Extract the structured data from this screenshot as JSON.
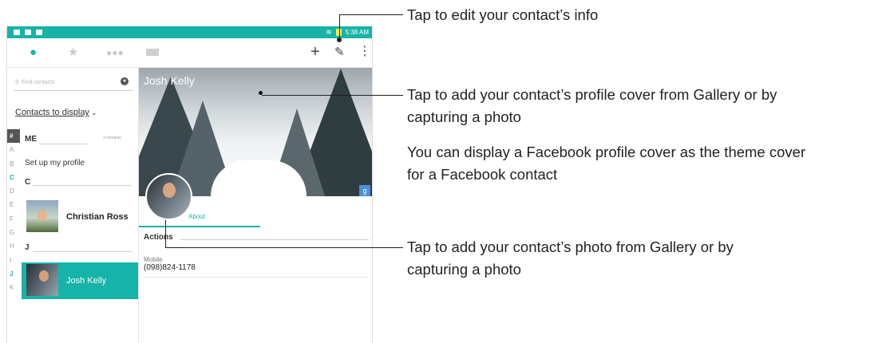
{
  "status_bar": {
    "time": "5:38 AM"
  },
  "search": {
    "placeholder": "Find contacts"
  },
  "contacts_display": {
    "label": "Contacts to display"
  },
  "alpha_index": [
    "#",
    "A",
    "B",
    "C",
    "D",
    "E",
    "F",
    "G",
    "H",
    "I",
    "J",
    "K"
  ],
  "list": {
    "me_header": "ME",
    "me_count": "3 contacts",
    "setup_profile": "Set up my profile",
    "c_header": "C",
    "j_header": "J",
    "contacts": [
      {
        "name": "Christian Ross"
      },
      {
        "name": "Josh Kelly"
      }
    ]
  },
  "detail": {
    "cover_name": "Josh Kelly",
    "tab_about": "About",
    "actions_header": "Actions",
    "mobile_label": "Mobile",
    "mobile_number": "(098)824-1178",
    "google_badge": "g"
  },
  "callouts": {
    "edit_info": "Tap to edit your contact’s info",
    "cover_line1": "Tap to add your contact’s profile cover from Gallery or by",
    "cover_line2": "capturing a photo",
    "facebook_line1": "You can display a Facebook profile cover as the theme cover",
    "facebook_line2": "for a Facebook contact",
    "photo_line1": "Tap to add your contact’s photo from Gallery or by",
    "photo_line2": "capturing a photo"
  },
  "colors": {
    "accent": "#17b3a8",
    "text": "#231f20"
  }
}
